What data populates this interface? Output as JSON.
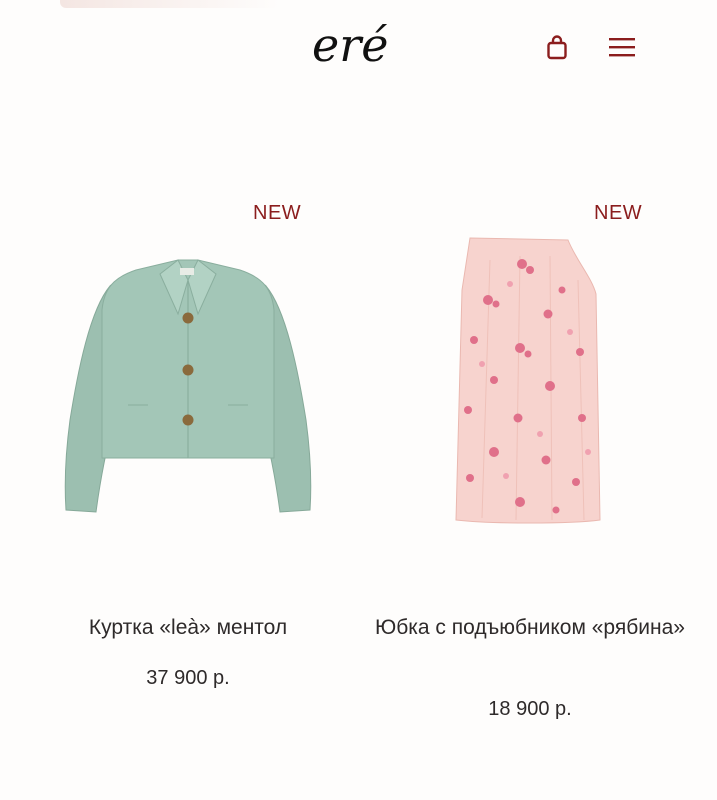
{
  "header": {
    "logo_text": "eré",
    "cart_icon": "shopping-bag-icon",
    "menu_icon": "hamburger-menu-icon"
  },
  "colors": {
    "accent": "#8b1d1d",
    "background": "#fefdfc",
    "text": "#2e2a2a"
  },
  "products": [
    {
      "badge": "NEW",
      "name": "Куртка «leà» ментол",
      "price": "37 900 р.",
      "image": "mint-jacket"
    },
    {
      "badge": "NEW",
      "name": "Юбка с подъюбником «рябина»",
      "price": "18 900 р.",
      "image": "pink-floral-skirt"
    }
  ]
}
